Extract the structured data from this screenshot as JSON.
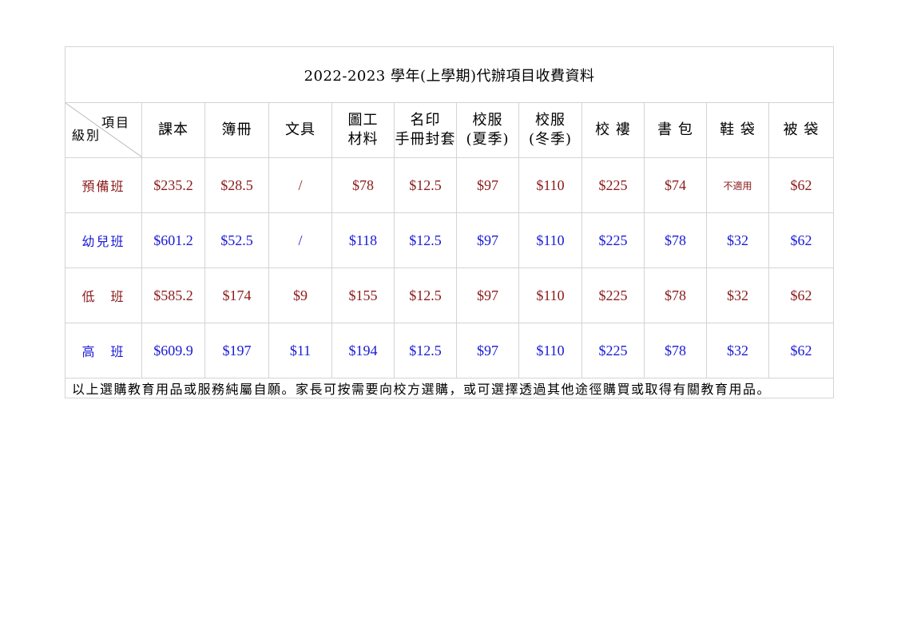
{
  "title": "2022-2023 學年(上學期)代辦項目收費資料",
  "corner": {
    "top": "項目",
    "bottom": "級別"
  },
  "headers": [
    [
      "課本"
    ],
    [
      "簿冊"
    ],
    [
      "文具"
    ],
    [
      "圖工",
      "材料"
    ],
    [
      "名印",
      "手冊封套"
    ],
    [
      "校服",
      "(夏季)"
    ],
    [
      "校服",
      "(冬季)"
    ],
    [
      "校 褸"
    ],
    [
      "書 包"
    ],
    [
      "鞋 袋"
    ],
    [
      "被 袋"
    ]
  ],
  "rows": [
    {
      "grade": "預備班",
      "color": "#8b1a1a",
      "values": [
        "$235.2",
        "$28.5",
        "/",
        "$78",
        "$12.5",
        "$97",
        "$110",
        "$225",
        "$74",
        "不適用",
        "$62"
      ]
    },
    {
      "grade": "幼兒班",
      "color": "#1a1ad6",
      "values": [
        "$601.2",
        "$52.5",
        "/",
        "$118",
        "$12.5",
        "$97",
        "$110",
        "$225",
        "$78",
        "$32",
        "$62"
      ]
    },
    {
      "grade": "低　班",
      "color": "#8b1a1a",
      "values": [
        "$585.2",
        "$174",
        "$9",
        "$155",
        "$12.5",
        "$97",
        "$110",
        "$225",
        "$78",
        "$32",
        "$62"
      ]
    },
    {
      "grade": "高　班",
      "color": "#1a1ad6",
      "values": [
        "$609.9",
        "$197",
        "$11",
        "$194",
        "$12.5",
        "$97",
        "$110",
        "$225",
        "$78",
        "$32",
        "$62"
      ]
    }
  ],
  "footer": "以上選購教育用品或服務純屬自願。家長可按需要向校方選購，或可選擇透過其他途徑購買或取得有關教育用品。"
}
